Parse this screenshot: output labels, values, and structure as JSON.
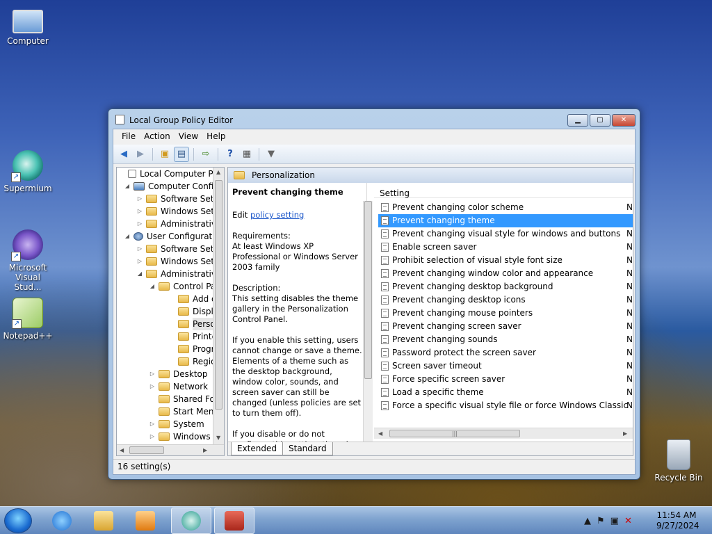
{
  "desktop": {
    "icons": [
      {
        "label": "Computer"
      },
      {
        "label": "Supermium"
      },
      {
        "label": "Microsoft Visual Stud..."
      },
      {
        "label": "Notepad++"
      },
      {
        "label": "Recycle Bin"
      }
    ]
  },
  "window": {
    "title": "Local Group Policy Editor",
    "menu": [
      "File",
      "Action",
      "View",
      "Help"
    ],
    "tree": [
      {
        "label": "Local Computer Polic",
        "expander": "",
        "icon": "policy-icon"
      },
      {
        "label": "Computer Config",
        "expander": "◢",
        "icon": "computer-icon"
      },
      {
        "label": "Software Setti",
        "expander": "▷",
        "icon": "folder-icon"
      },
      {
        "label": "Windows Sett",
        "expander": "▷",
        "icon": "folder-icon"
      },
      {
        "label": "Administrative",
        "expander": "▷",
        "icon": "folder-icon"
      },
      {
        "label": "User Configuratio",
        "expander": "◢",
        "icon": "user-icon"
      },
      {
        "label": "Software Setti",
        "expander": "▷",
        "icon": "folder-icon"
      },
      {
        "label": "Windows Sett",
        "expander": "▷",
        "icon": "folder-icon"
      },
      {
        "label": "Administrative",
        "expander": "◢",
        "icon": "folder-icon"
      },
      {
        "label": "Control Pa",
        "expander": "◢",
        "icon": "folder-icon"
      },
      {
        "label": "Add or",
        "expander": "",
        "icon": "folder-icon"
      },
      {
        "label": "Display",
        "expander": "",
        "icon": "folder-icon"
      },
      {
        "label": "Person",
        "expander": "",
        "icon": "folder-icon"
      },
      {
        "label": "Printer",
        "expander": "",
        "icon": "folder-icon"
      },
      {
        "label": "Progra",
        "expander": "",
        "icon": "folder-icon"
      },
      {
        "label": "Region",
        "expander": "",
        "icon": "folder-icon"
      },
      {
        "label": "Desktop",
        "expander": "▷",
        "icon": "folder-icon"
      },
      {
        "label": "Network",
        "expander": "▷",
        "icon": "folder-icon"
      },
      {
        "label": "Shared Fol",
        "expander": "",
        "icon": "folder-icon"
      },
      {
        "label": "Start Menu",
        "expander": "",
        "icon": "folder-icon"
      },
      {
        "label": "System",
        "expander": "▷",
        "icon": "folder-icon"
      },
      {
        "label": "Windows C",
        "expander": "▷",
        "icon": "folder-icon"
      }
    ],
    "header": "Personalization",
    "description": {
      "title": "Prevent changing theme",
      "edit_prefix": "Edit ",
      "edit_link": "policy setting",
      "requirements": "Requirements:",
      "requirements_text": "At least Windows XP Professional or Windows Server 2003 family",
      "description_label": "Description:",
      "description_text": "This setting disables the theme gallery in the Personalization Control Panel.",
      "enable_text": "If you enable this setting, users cannot change or save a theme. Elements of a theme such as the desktop background, window color, sounds, and screen saver can still be changed (unless policies are set to turn them off).",
      "disable_text": "If you disable or do not configure this setting, there is no effect."
    },
    "list_header": "Setting",
    "settings": [
      {
        "name": "Prevent changing color scheme",
        "state": "N"
      },
      {
        "name": "Prevent changing theme",
        "state": ""
      },
      {
        "name": "Prevent changing visual style for windows and buttons",
        "state": "N"
      },
      {
        "name": "Enable screen saver",
        "state": "N"
      },
      {
        "name": "Prohibit selection of visual style font size",
        "state": "N"
      },
      {
        "name": "Prevent changing window color and appearance",
        "state": "N"
      },
      {
        "name": "Prevent changing desktop background",
        "state": "N"
      },
      {
        "name": "Prevent changing desktop icons",
        "state": "N"
      },
      {
        "name": "Prevent changing mouse pointers",
        "state": "N"
      },
      {
        "name": "Prevent changing screen saver",
        "state": "N"
      },
      {
        "name": "Prevent changing sounds",
        "state": "N"
      },
      {
        "name": "Password protect the screen saver",
        "state": "N"
      },
      {
        "name": "Screen saver timeout",
        "state": "N"
      },
      {
        "name": "Force specific screen saver",
        "state": "N"
      },
      {
        "name": "Load a specific theme",
        "state": "N"
      },
      {
        "name": "Force a specific visual style file or force Windows Classic",
        "state": "N"
      }
    ],
    "selected_index": 1,
    "tabs": [
      "Extended",
      "Standard"
    ],
    "status": "16 setting(s)"
  },
  "taskbar": {
    "time": "11:54 AM",
    "date": "9/27/2024"
  },
  "colors": {
    "selection": "#3399ff",
    "link": "#1a55c9"
  }
}
